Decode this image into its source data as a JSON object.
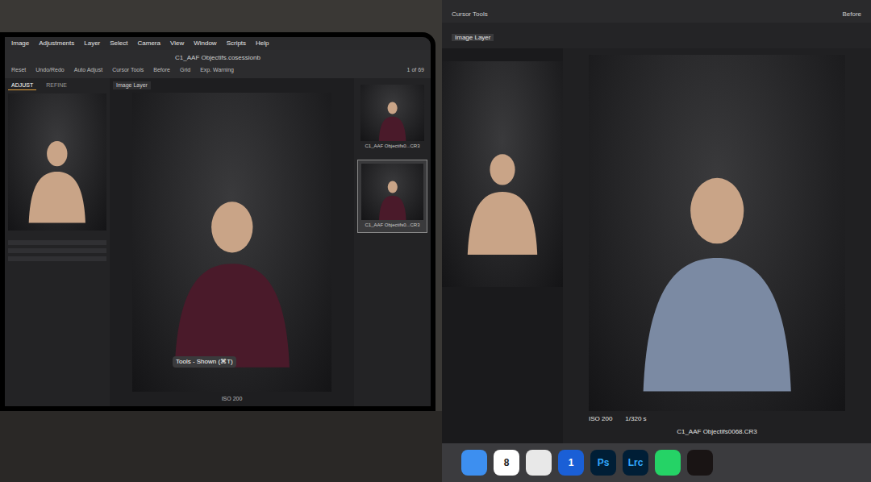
{
  "left_screen": {
    "menu": [
      "Image",
      "Adjustments",
      "Layer",
      "Select",
      "Camera",
      "View",
      "Window",
      "Scripts",
      "Help"
    ],
    "title": "C1_AAF Objectifs.cosessionb",
    "toolbar": [
      "Reset",
      "Undo/Redo",
      "Auto Adjust",
      "Cursor Tools",
      "Before",
      "Grid",
      "Exp. Warning"
    ],
    "tool_tabs": [
      {
        "label": "ADJUST",
        "selected": true
      },
      {
        "label": "REFINE",
        "selected": false
      }
    ],
    "layer": "Image Layer",
    "counter": "1 of 69",
    "filmstrip": [
      {
        "label": "C1_AAF Objectifs0...CR3",
        "selected": false
      },
      {
        "label": "C1_AAF Objectifs0...CR3",
        "selected": true
      }
    ],
    "tooltip": "Tools - Shown (⌘T)",
    "iso": "ISO 200"
  },
  "right_screen": {
    "toolbar": [
      "Cursor Tools",
      "Before"
    ],
    "layer": "Image Layer",
    "info": [
      "ISO 200",
      "1/320 s"
    ],
    "filename": "C1_AAF Objectifs0068.CR3",
    "dock": [
      {
        "kind": "finder",
        "label": "",
        "color": "#3d8ff0"
      },
      {
        "kind": "calendar",
        "label": "8",
        "color": "#ffffff"
      },
      {
        "kind": "chrome",
        "label": "",
        "color": "#e8e8e8"
      },
      {
        "kind": "onepassword",
        "label": "1",
        "color": "#1a5fd6"
      },
      {
        "kind": "photoshop",
        "label": "Ps",
        "color": "#001e36"
      },
      {
        "kind": "lightroom",
        "label": "Lrc",
        "color": "#001e36"
      },
      {
        "kind": "whatsapp",
        "label": "",
        "color": "#25d366"
      },
      {
        "kind": "spotify",
        "label": "",
        "color": "#191414"
      }
    ]
  }
}
